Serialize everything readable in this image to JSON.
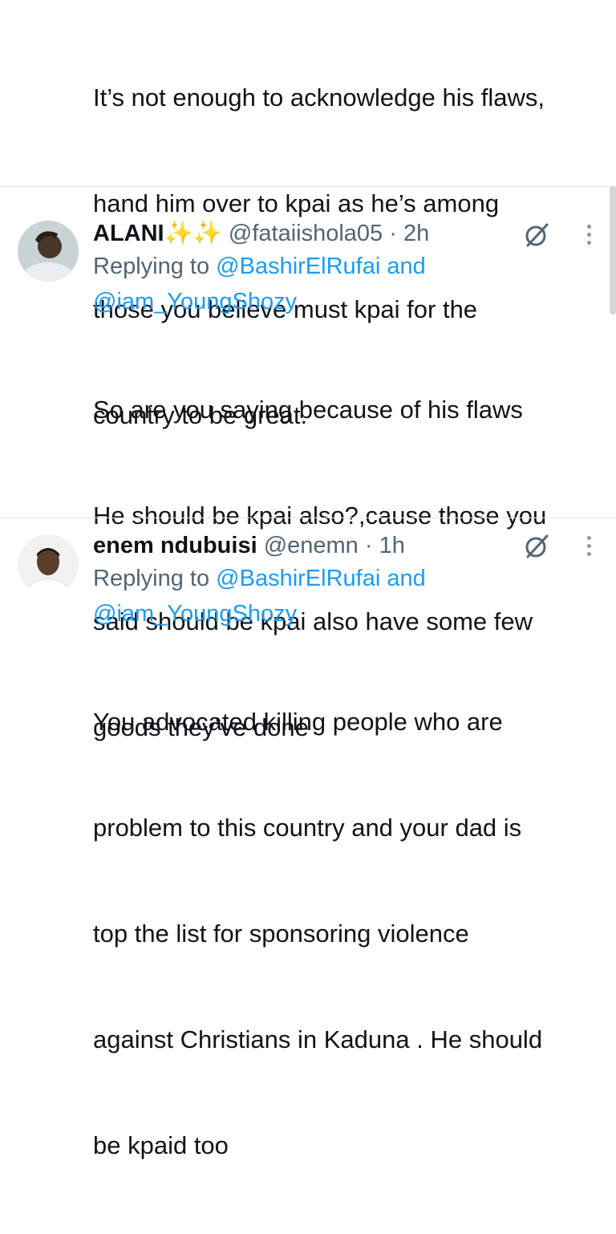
{
  "tweets": [
    {
      "text_lines": [
        "It’s not enough to acknowledge his flaws,",
        "hand him over to kpai as he’s among",
        "those you believe must kpai for the",
        "country to be great."
      ]
    },
    {
      "name": "ALANI",
      "emoji": "✨✨",
      "handle": "@fataiishola05",
      "time": "2h",
      "replying_label": "Replying to",
      "reply_mention_1": "@BashirElRufai",
      "reply_and": "and",
      "reply_mention_2": "@iam_YoungShozy",
      "text_lines": [
        "So are you saying because of his flaws",
        "He should be kpai also?,cause those you",
        "said should be kpai also have some few",
        "goods they’ve done"
      ]
    },
    {
      "name": "enem ndubuisi",
      "handle": "@enemn",
      "time": "1h",
      "replying_label": "Replying to",
      "reply_mention_1": "@BashirElRufai",
      "reply_and": "and",
      "reply_mention_2": "@iam_YoungShozy",
      "text_lines": [
        "You advocated killing people who are",
        "problem to this country and your dad is",
        "top the list for sponsoring violence",
        "against Christians in Kaduna . He should",
        "be kpaid too"
      ]
    }
  ],
  "colors": {
    "text": "#0f1419",
    "secondary": "#536471",
    "link": "#1d9bf0",
    "divider": "#e2e5e8"
  },
  "icons": {
    "grok": "grok-icon",
    "more": "more-vertical-icon"
  }
}
